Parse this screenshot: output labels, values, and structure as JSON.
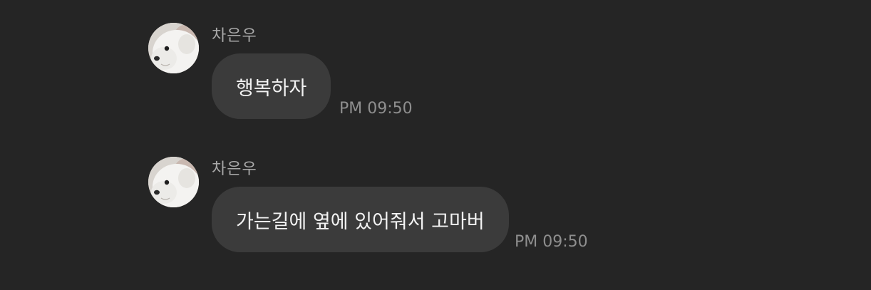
{
  "colors": {
    "background": "#252525",
    "bubble": "#3b3b3b",
    "sender_text": "#a9a9a9",
    "message_text": "#f2f2f2",
    "time_text": "#8e8e8e"
  },
  "messages": [
    {
      "sender": "차은우",
      "avatar_icon": "white-dog-avatar",
      "text": "행복하자",
      "time": "PM 09:50"
    },
    {
      "sender": "차은우",
      "avatar_icon": "white-dog-avatar",
      "text": "가는길에 옆에 있어줘서 고마버",
      "time": "PM 09:50"
    }
  ]
}
